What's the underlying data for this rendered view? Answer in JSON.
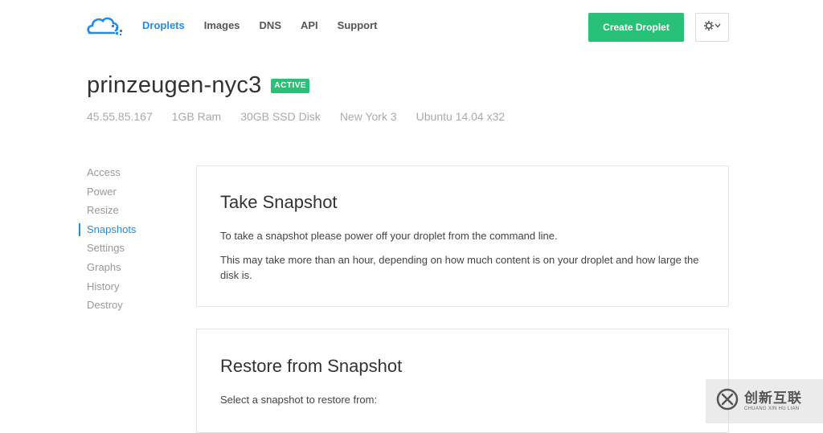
{
  "header": {
    "logo_icon": "cloud-logo-icon",
    "nav": [
      {
        "label": "Droplets",
        "active": true
      },
      {
        "label": "Images",
        "active": false
      },
      {
        "label": "DNS",
        "active": false
      },
      {
        "label": "API",
        "active": false
      },
      {
        "label": "Support",
        "active": false
      }
    ],
    "create_button_label": "Create Droplet",
    "settings_icon": "gear-icon"
  },
  "droplet": {
    "name": "prinzeugen-nyc3",
    "status": "ACTIVE",
    "meta": {
      "ip": "45.55.85.167",
      "ram": "1GB Ram",
      "disk": "30GB SSD Disk",
      "region": "New York 3",
      "image": "Ubuntu 14.04 x32"
    }
  },
  "sidebar": {
    "items": [
      {
        "label": "Access",
        "active": false
      },
      {
        "label": "Power",
        "active": false
      },
      {
        "label": "Resize",
        "active": false
      },
      {
        "label": "Snapshots",
        "active": true
      },
      {
        "label": "Settings",
        "active": false
      },
      {
        "label": "Graphs",
        "active": false
      },
      {
        "label": "History",
        "active": false
      },
      {
        "label": "Destroy",
        "active": false
      }
    ]
  },
  "take_snapshot": {
    "title": "Take Snapshot",
    "line1": "To take a snapshot please power off your droplet from the command line.",
    "line2": "This may take more than an hour, depending on how much content is on your droplet and how large the disk is."
  },
  "restore_snapshot": {
    "title": "Restore from Snapshot",
    "line1": "Select a snapshot to restore from:"
  },
  "watermark": {
    "cn": "创新互联",
    "en": "CHUANG XIN HU LIAN"
  },
  "colors": {
    "accent": "#1f8ceb",
    "success": "#27c277"
  }
}
